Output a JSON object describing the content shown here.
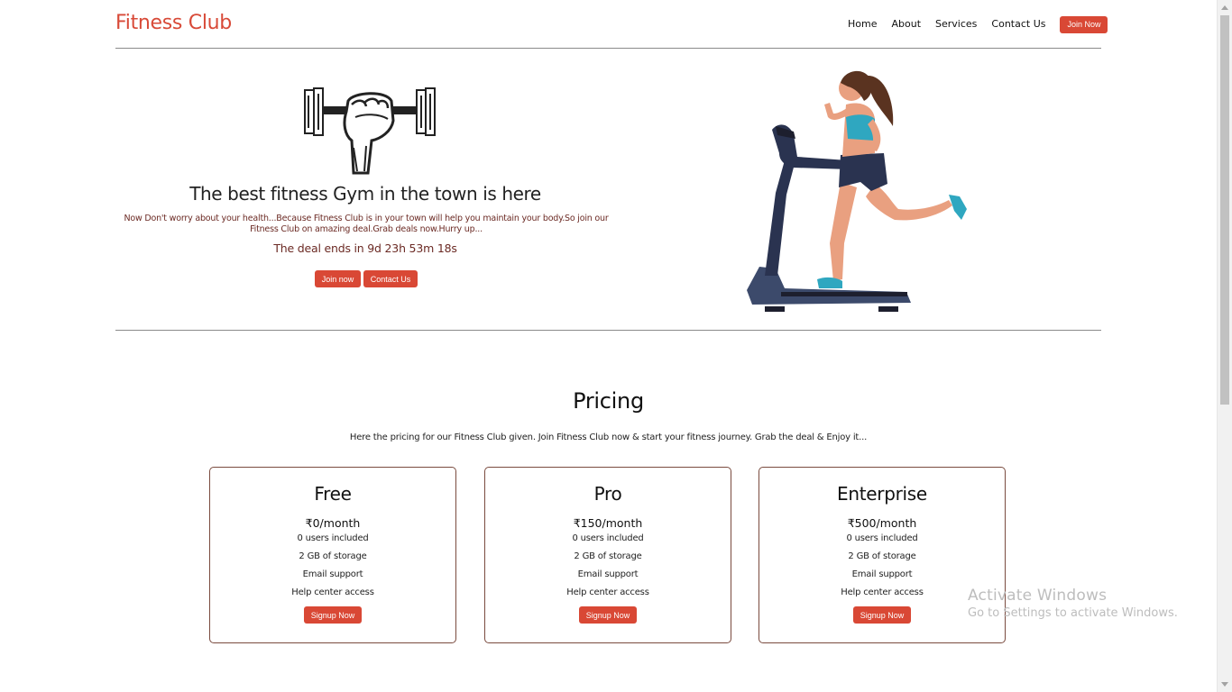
{
  "header": {
    "brand": "Fitness Club",
    "nav": [
      {
        "label": "Home"
      },
      {
        "label": "About"
      },
      {
        "label": "Services"
      },
      {
        "label": "Contact Us"
      }
    ],
    "join_button": "Join Now"
  },
  "hero": {
    "title": "The best fitness Gym in the town is here",
    "description": "Now Don't worry about your health...Because Fitness Club is in your town will help you maintain your body.So join our Fitness Club on amazing deal.Grab deals now.Hurry up...",
    "deal": "The deal ends in 9d 23h 53m 18s",
    "join_button": "Join now",
    "contact_button": "Contact Us"
  },
  "pricing": {
    "title": "Pricing",
    "subtitle": "Here the pricing for our Fitness Club given. Join Fitness Club now & start your fitness journey. Grab the deal & Enjoy it...",
    "plans": [
      {
        "name": "Free",
        "price": "₹0/month",
        "features": [
          "0 users included",
          "2 GB of storage",
          "Email support",
          "Help center access"
        ],
        "button": "Signup Now"
      },
      {
        "name": "Pro",
        "price": "₹150/month",
        "features": [
          "0 users included",
          "2 GB of storage",
          "Email support",
          "Help center access"
        ],
        "button": "Signup Now"
      },
      {
        "name": "Enterprise",
        "price": "₹500/month",
        "features": [
          "0 users included",
          "2 GB of storage",
          "Email support",
          "Help center access"
        ],
        "button": "Signup Now"
      }
    ]
  },
  "watermark": {
    "line1": "Activate Windows",
    "line2": "Go to Settings to activate Windows."
  },
  "colors": {
    "accent": "#d94835",
    "brand": "#d84a38",
    "text_dark_red": "#6b2a24"
  }
}
